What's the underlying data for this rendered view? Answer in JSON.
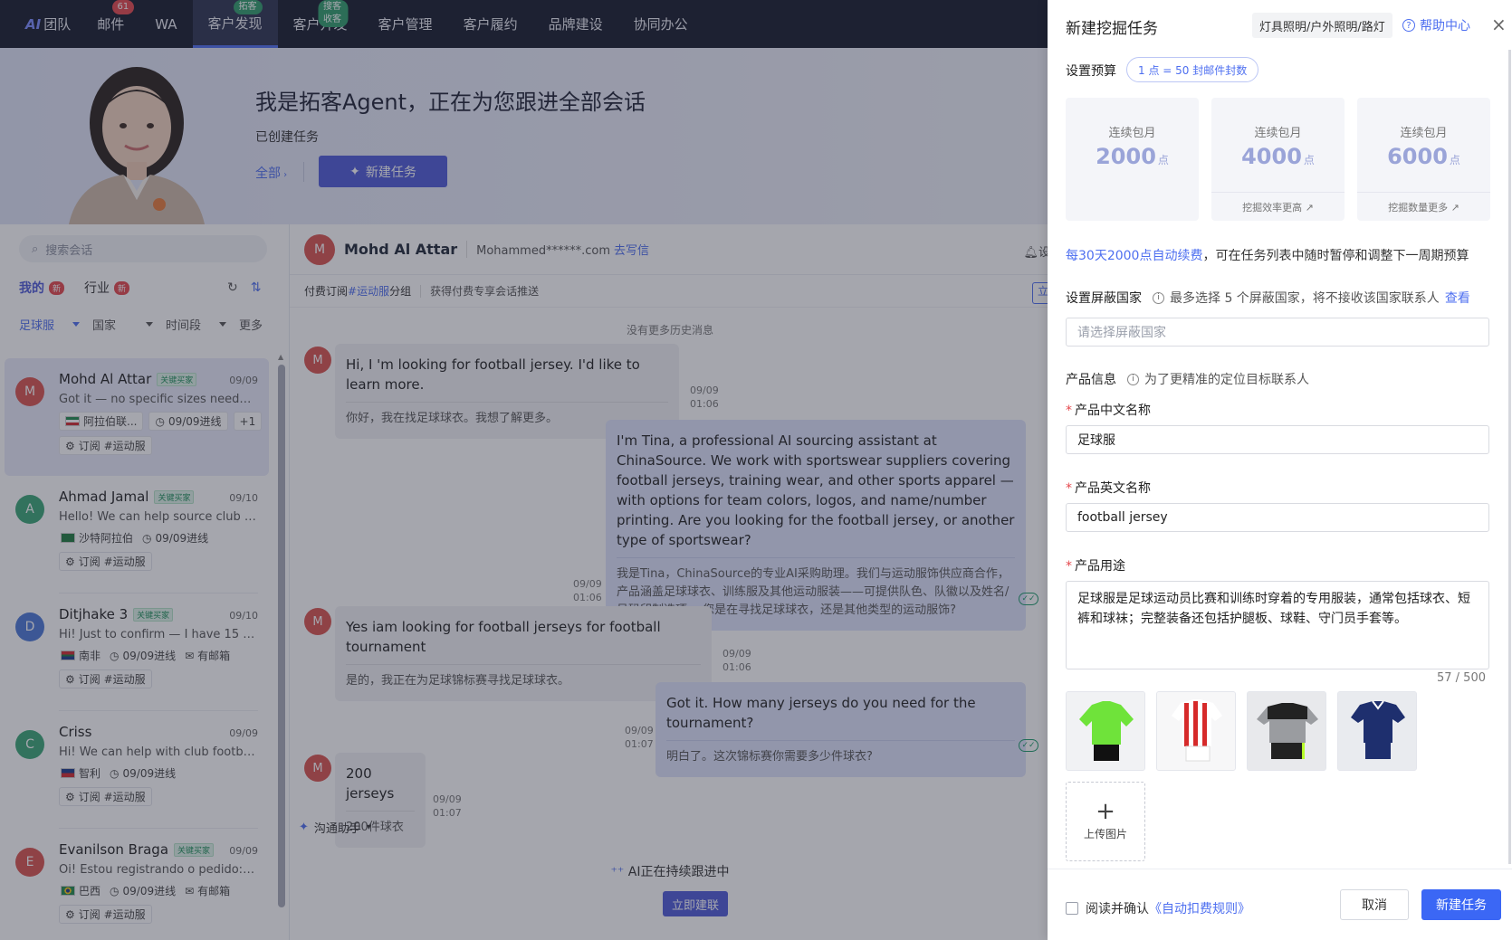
{
  "nav": {
    "logo_ai": "AI",
    "logo_label": "团队",
    "items": [
      {
        "label": "邮件",
        "badge": "61"
      },
      {
        "label": "WA",
        "badge": ""
      },
      {
        "label": "客户发现",
        "badge": "拓客"
      },
      {
        "label": "客户开发",
        "badge": "搜客收客"
      },
      {
        "label": "客户管理",
        "badge": ""
      },
      {
        "label": "客户履约",
        "badge": ""
      },
      {
        "label": "品牌建设",
        "badge": ""
      },
      {
        "label": "协同办公",
        "badge": ""
      }
    ]
  },
  "hero": {
    "title": "我是拓客Agent，正在为您跟进全部会话",
    "subtitle": "已创建任务",
    "all_link": "全部",
    "new_task_button": "新建任务"
  },
  "sidebar": {
    "search_placeholder": "搜索会话",
    "tabs": [
      {
        "label": "我的",
        "badge": "新"
      },
      {
        "label": "行业",
        "badge": "新"
      }
    ],
    "filters": [
      "足球服",
      "国家",
      "时间段",
      "更多"
    ]
  },
  "conversations": [
    {
      "initial": "M",
      "color": "#d9534f",
      "name": "Mohd Al Attar",
      "tag": "关键买家",
      "date": "09/09",
      "preview": "Got it — no specific sizes needed ye...",
      "country": "阿拉伯联...",
      "flag": "kw",
      "time": "09/09进线",
      "extra": "+1",
      "sub": "订阅 #运动服"
    },
    {
      "initial": "A",
      "color": "#3aa676",
      "name": "Ahmad Jamal",
      "tag": "关键买家",
      "date": "09/10",
      "preview": "Hello! We can help source club foot...",
      "country": "沙特阿拉伯",
      "flag": "sa",
      "time": "09/09进线",
      "extra": "",
      "sub": "订阅 #运动服"
    },
    {
      "initial": "D",
      "color": "#4a78d6",
      "name": "Ditjhake 3",
      "tag": "关键买家",
      "date": "09/10",
      "preview": "Hi! Just to confirm — I have 15 foot...",
      "country": "南非",
      "flag": "za",
      "time": "09/09进线",
      "extra": "有邮箱",
      "sub": "订阅 #运动服"
    },
    {
      "initial": "C",
      "color": "#3aa676",
      "name": "Criss",
      "tag": "",
      "date": "09/09",
      "preview": "Hi! We can help with club football je...",
      "country": "智利",
      "flag": "cl",
      "time": "09/09进线",
      "extra": "",
      "sub": "订阅 #运动服"
    },
    {
      "initial": "E",
      "color": "#d9534f",
      "name": "Evanilson Braga",
      "tag": "关键买家",
      "date": "09/09",
      "preview": "Oi! Estou registrando o pedido: kits ...",
      "country": "巴西",
      "flag": "br",
      "time": "09/09进线",
      "extra": "有邮箱",
      "sub": "订阅 #运动服"
    }
  ],
  "chat": {
    "contact_initial": "M",
    "contact_name": "Mohd Al Attar",
    "contact_email": "Mohammed******.com",
    "write_link": "去写信",
    "settings_label": "设",
    "sub_prefix": "付费订阅",
    "sub_hash": "#运动服",
    "sub_suffix": "分组",
    "sub_note": "获得付费专享会话推送",
    "sub_button": "立",
    "no_history": "没有更多历史消息",
    "messages": [
      {
        "text": "Hi, I  'm looking for football jersey. I'd like to learn more.",
        "tr": "你好，我在找足球球衣。我想了解更多。",
        "date": "09/09",
        "time": "01:06"
      },
      {
        "text": "I'm Tina, a professional AI sourcing assistant at ChinaSource. We work with sportswear suppliers covering football jerseys, training wear, and other sports apparel — with options for team colors, logos, and name/number printing. Are you looking for the football jersey, or another type of sportswear?",
        "tr": "我是Tina，ChinaSource的专业AI采购助理。我们与运动服饰供应商合作，产品涵盖足球球衣、训练服及其他运动服装——可提供队色、队徽以及姓名/号码印制选项。 您是在寻找足球球衣，还是其他类型的运动服饰?",
        "date": "09/09",
        "time": "01:06"
      },
      {
        "text": "Yes iam looking for football jerseys for football tournament",
        "tr": "是的，我正在为足球锦标赛寻找足球球衣。",
        "date": "09/09",
        "time": "01:06"
      },
      {
        "text": "Got it. How many jerseys do you need for the tournament?",
        "tr": "明白了。这次锦标赛你需要多少件球衣?",
        "date": "09/09",
        "time": "01:07"
      },
      {
        "text": "200 jerseys",
        "tr": "200件球衣",
        "date": "09/09",
        "time": "01:07"
      }
    ],
    "helper_label": "沟通助手",
    "ai_status": "AI正在持续跟进中",
    "connect_button": "立即建联"
  },
  "drawer": {
    "title": "新建挖掘任务",
    "category_path": "灯具照明/户外照明/路灯",
    "help": "帮助中心",
    "budget_label": "设置预算",
    "rate": "1 点 = 50 封邮件封数",
    "plans": [
      {
        "label": "连续包月",
        "value": "2000",
        "unit": "点",
        "foot": ""
      },
      {
        "label": "连续包月",
        "value": "4000",
        "unit": "点",
        "foot": "挖掘效率更高 ↗"
      },
      {
        "label": "连续包月",
        "value": "6000",
        "unit": "点",
        "foot": "挖掘数量更多 ↗"
      }
    ],
    "renew_highlight": "每30天2000点自动续费",
    "renew_rest": "，可在任务列表中随时暂停和调整下一周期预算",
    "block_label": "设置屏蔽国家",
    "block_hint": "最多选择 5 个屏蔽国家，将不接收该国家联系人",
    "block_link": "查看",
    "block_placeholder": "请选择屏蔽国家",
    "product_label": "产品信息",
    "product_hint": "为了更精准的定位目标联系人",
    "cn_name_label": "产品中文名称",
    "cn_name_value": "足球服",
    "en_name_label": "产品英文名称",
    "en_name_value": "football jersey",
    "usage_label": "产品用途",
    "usage_value": "足球服是足球运动员比赛和训练时穿着的专用服装，通常包括球衣、短裤和球袜；完整装备还包括护腿板、球鞋、守门员手套等。",
    "counter": "57 / 500",
    "upload_label": "上传图片",
    "agree_prefix": "阅读并确认",
    "agree_link": "《自动扣费规则》",
    "cancel": "取消",
    "submit": "新建任务"
  }
}
